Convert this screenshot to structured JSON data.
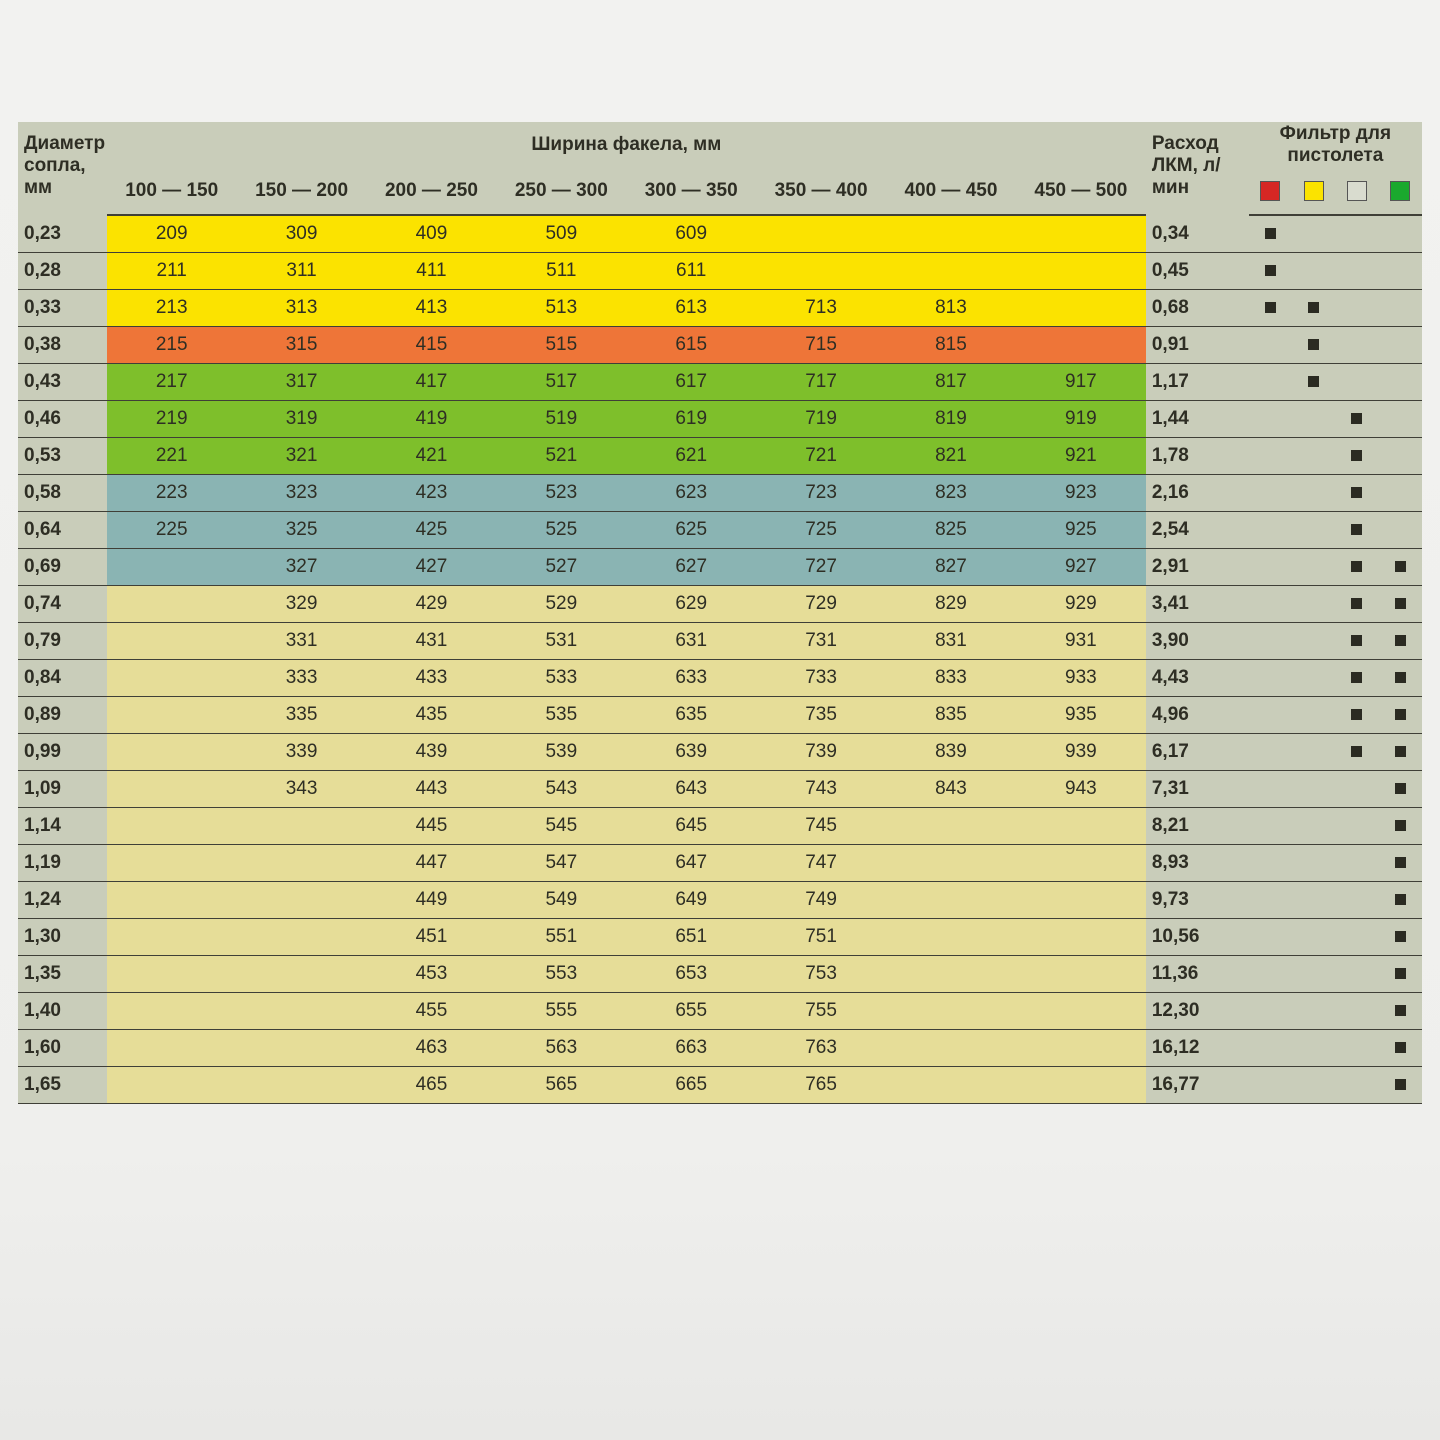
{
  "headers": {
    "diameter": "Диаметр сопла, мм",
    "spray_width": "Ширина факела, мм",
    "flow": "Расход ЛКМ, л/мин",
    "filter": "Фильтр для пистолета",
    "ranges": [
      "100 — 150",
      "150 — 200",
      "200 — 250",
      "250 — 300",
      "300 — 350",
      "350 — 400",
      "400 — 450",
      "450 — 500"
    ]
  },
  "filter_colors": [
    "red",
    "yellow",
    "grey",
    "green"
  ],
  "rows": [
    {
      "d": "0,23",
      "bg": "yellow",
      "cells": [
        "209",
        "309",
        "409",
        "509",
        "609",
        "",
        "",
        ""
      ],
      "flow": "0,34",
      "filters": [
        1,
        0,
        0,
        0
      ]
    },
    {
      "d": "0,28",
      "bg": "yellow",
      "cells": [
        "211",
        "311",
        "411",
        "511",
        "611",
        "",
        "",
        ""
      ],
      "flow": "0,45",
      "filters": [
        1,
        0,
        0,
        0
      ]
    },
    {
      "d": "0,33",
      "bg": "yellow",
      "cells": [
        "213",
        "313",
        "413",
        "513",
        "613",
        "713",
        "813",
        ""
      ],
      "flow": "0,68",
      "filters": [
        1,
        1,
        0,
        0
      ]
    },
    {
      "d": "0,38",
      "bg": "orange",
      "cells": [
        "215",
        "315",
        "415",
        "515",
        "615",
        "715",
        "815",
        ""
      ],
      "flow": "0,91",
      "filters": [
        0,
        1,
        0,
        0
      ]
    },
    {
      "d": "0,43",
      "bg": "green",
      "cells": [
        "217",
        "317",
        "417",
        "517",
        "617",
        "717",
        "817",
        "917"
      ],
      "flow": "1,17",
      "filters": [
        0,
        1,
        0,
        0
      ]
    },
    {
      "d": "0,46",
      "bg": "green",
      "cells": [
        "219",
        "319",
        "419",
        "519",
        "619",
        "719",
        "819",
        "919"
      ],
      "flow": "1,44",
      "filters": [
        0,
        0,
        1,
        0
      ]
    },
    {
      "d": "0,53",
      "bg": "green",
      "cells": [
        "221",
        "321",
        "421",
        "521",
        "621",
        "721",
        "821",
        "921"
      ],
      "flow": "1,78",
      "filters": [
        0,
        0,
        1,
        0
      ]
    },
    {
      "d": "0,58",
      "bg": "teal",
      "cells": [
        "223",
        "323",
        "423",
        "523",
        "623",
        "723",
        "823",
        "923"
      ],
      "flow": "2,16",
      "filters": [
        0,
        0,
        1,
        0
      ]
    },
    {
      "d": "0,64",
      "bg": "teal",
      "cells": [
        "225",
        "325",
        "425",
        "525",
        "625",
        "725",
        "825",
        "925"
      ],
      "flow": "2,54",
      "filters": [
        0,
        0,
        1,
        0
      ]
    },
    {
      "d": "0,69",
      "bg": "teal",
      "cells": [
        "",
        "327",
        "427",
        "527",
        "627",
        "727",
        "827",
        "927"
      ],
      "flow": "2,91",
      "filters": [
        0,
        0,
        1,
        1
      ]
    },
    {
      "d": "0,74",
      "bg": "sand",
      "cells": [
        "",
        "329",
        "429",
        "529",
        "629",
        "729",
        "829",
        "929"
      ],
      "flow": "3,41",
      "filters": [
        0,
        0,
        1,
        1
      ]
    },
    {
      "d": "0,79",
      "bg": "sand",
      "cells": [
        "",
        "331",
        "431",
        "531",
        "631",
        "731",
        "831",
        "931"
      ],
      "flow": "3,90",
      "filters": [
        0,
        0,
        1,
        1
      ]
    },
    {
      "d": "0,84",
      "bg": "sand",
      "cells": [
        "",
        "333",
        "433",
        "533",
        "633",
        "733",
        "833",
        "933"
      ],
      "flow": "4,43",
      "filters": [
        0,
        0,
        1,
        1
      ]
    },
    {
      "d": "0,89",
      "bg": "sand",
      "cells": [
        "",
        "335",
        "435",
        "535",
        "635",
        "735",
        "835",
        "935"
      ],
      "flow": "4,96",
      "filters": [
        0,
        0,
        1,
        1
      ]
    },
    {
      "d": "0,99",
      "bg": "sand",
      "cells": [
        "",
        "339",
        "439",
        "539",
        "639",
        "739",
        "839",
        "939"
      ],
      "flow": "6,17",
      "filters": [
        0,
        0,
        1,
        1
      ]
    },
    {
      "d": "1,09",
      "bg": "sand",
      "cells": [
        "",
        "343",
        "443",
        "543",
        "643",
        "743",
        "843",
        "943"
      ],
      "flow": "7,31",
      "filters": [
        0,
        0,
        0,
        1
      ]
    },
    {
      "d": "1,14",
      "bg": "sand",
      "cells": [
        "",
        "",
        "445",
        "545",
        "645",
        "745",
        "",
        ""
      ],
      "flow": "8,21",
      "filters": [
        0,
        0,
        0,
        1
      ]
    },
    {
      "d": "1,19",
      "bg": "sand",
      "cells": [
        "",
        "",
        "447",
        "547",
        "647",
        "747",
        "",
        ""
      ],
      "flow": "8,93",
      "filters": [
        0,
        0,
        0,
        1
      ]
    },
    {
      "d": "1,24",
      "bg": "sand",
      "cells": [
        "",
        "",
        "449",
        "549",
        "649",
        "749",
        "",
        ""
      ],
      "flow": "9,73",
      "filters": [
        0,
        0,
        0,
        1
      ]
    },
    {
      "d": "1,30",
      "bg": "sand",
      "cells": [
        "",
        "",
        "451",
        "551",
        "651",
        "751",
        "",
        ""
      ],
      "flow": "10,56",
      "filters": [
        0,
        0,
        0,
        1
      ]
    },
    {
      "d": "1,35",
      "bg": "sand",
      "cells": [
        "",
        "",
        "453",
        "553",
        "653",
        "753",
        "",
        ""
      ],
      "flow": "11,36",
      "filters": [
        0,
        0,
        0,
        1
      ]
    },
    {
      "d": "1,40",
      "bg": "sand",
      "cells": [
        "",
        "",
        "455",
        "555",
        "655",
        "755",
        "",
        ""
      ],
      "flow": "12,30",
      "filters": [
        0,
        0,
        0,
        1
      ]
    },
    {
      "d": "1,60",
      "bg": "sand",
      "cells": [
        "",
        "",
        "463",
        "563",
        "663",
        "763",
        "",
        ""
      ],
      "flow": "16,12",
      "filters": [
        0,
        0,
        0,
        1
      ]
    },
    {
      "d": "1,65",
      "bg": "sand",
      "cells": [
        "",
        "",
        "465",
        "565",
        "665",
        "765",
        "",
        ""
      ],
      "flow": "16,77",
      "filters": [
        0,
        0,
        0,
        1
      ]
    }
  ]
}
